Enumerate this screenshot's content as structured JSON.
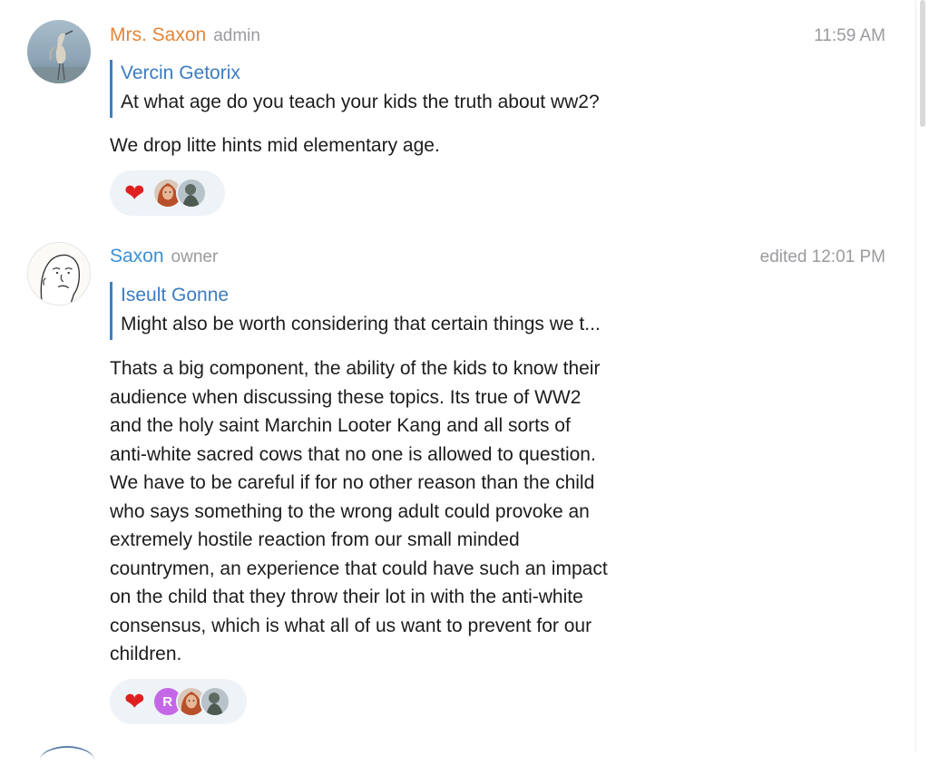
{
  "messages": [
    {
      "sender": "Mrs. Saxon",
      "role": "admin",
      "time": "11:59 AM",
      "sender_color": "#e2853a",
      "reply": {
        "name": "Vercin Getorix",
        "text": "At what age do you teach your kids the truth about ww2?"
      },
      "text": "We drop litte hints mid elementary age.",
      "reactions": {
        "emoji_icon": "red-heart-icon",
        "avatars": [
          "red-haired-woman-avatar",
          "statue-avatar"
        ]
      }
    },
    {
      "sender": "Saxon",
      "role": "owner",
      "time": "edited 12:01 PM",
      "sender_color": "#3b8fd6",
      "reply": {
        "name": "Iseult Gonne",
        "text": "Might also be worth considering that certain things we t..."
      },
      "lines": [
        "Thats a big component, the ability of the kids to know their",
        "audience when discussing these topics. Its true of WW2",
        "and the holy saint Marchin Looter Kang and all sorts of",
        "anti-white sacred cows that no one is allowed to question.",
        "We have to be careful if for no other reason than the child",
        "who says something to the wrong adult could provoke an",
        "extremely hostile reaction from our small minded",
        "countrymen, an experience that could have such an impact",
        "on the child that they throw their lot in with the anti-white",
        "consensus, which is what all of us want to prevent for our",
        "children."
      ],
      "reactions": {
        "emoji_icon": "red-heart-icon",
        "letter_avatar": "R",
        "avatars": [
          "red-haired-woman-avatar",
          "statue-avatar"
        ]
      }
    }
  ],
  "colors": {
    "accent_blue": "#3b7cc2",
    "reaction_bg": "#eef3f8",
    "meta_gray": "#9a9a9f"
  }
}
